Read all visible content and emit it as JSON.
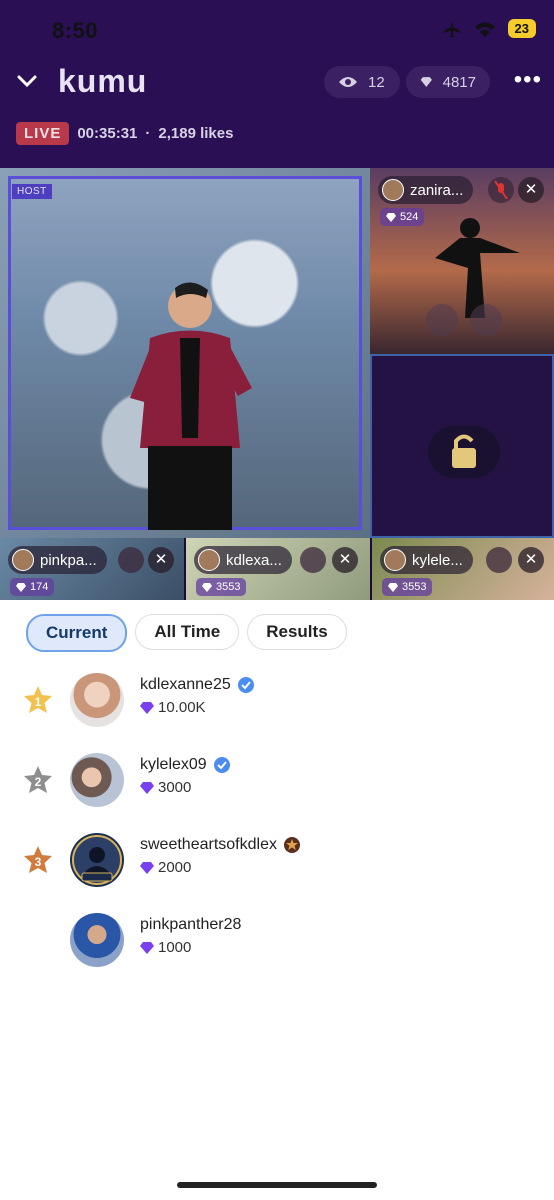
{
  "status_bar": {
    "time": "8:50",
    "battery": "23"
  },
  "header": {
    "title": "kumu",
    "viewers": "12",
    "diamonds": "4817"
  },
  "stream": {
    "live_label": "LIVE",
    "elapsed": "00:35:31",
    "separator": "·",
    "likes": "2,189 likes"
  },
  "grid": {
    "host_label": "HOST",
    "slots": [
      {
        "name": "zanira...",
        "gems": "524"
      },
      {
        "name": "pinkpa...",
        "gems": "174"
      },
      {
        "name": "kdlexa...",
        "gems": "3553"
      },
      {
        "name": "kylele...",
        "gems": "3553"
      }
    ]
  },
  "tabs": [
    {
      "label": "Current",
      "active": true
    },
    {
      "label": "All Time",
      "active": false
    },
    {
      "label": "Results",
      "active": false
    }
  ],
  "leaderboard": [
    {
      "rank": "1",
      "username": "kdlexanne25",
      "score": "10.00K",
      "badge": "verified"
    },
    {
      "rank": "2",
      "username": "kylelex09",
      "score": "3000",
      "badge": "verified"
    },
    {
      "rank": "3",
      "username": "sweetheartsofkdlex",
      "score": "2000",
      "badge": "star"
    },
    {
      "rank": "",
      "username": "pinkpanther28",
      "score": "1000",
      "badge": ""
    }
  ],
  "icons": {
    "gem_color": "#7b3ff2",
    "verified_color": "#4a8cf0",
    "gold": "#f2c14e",
    "silver": "#8e8e8e",
    "bronze": "#d27b3e"
  }
}
